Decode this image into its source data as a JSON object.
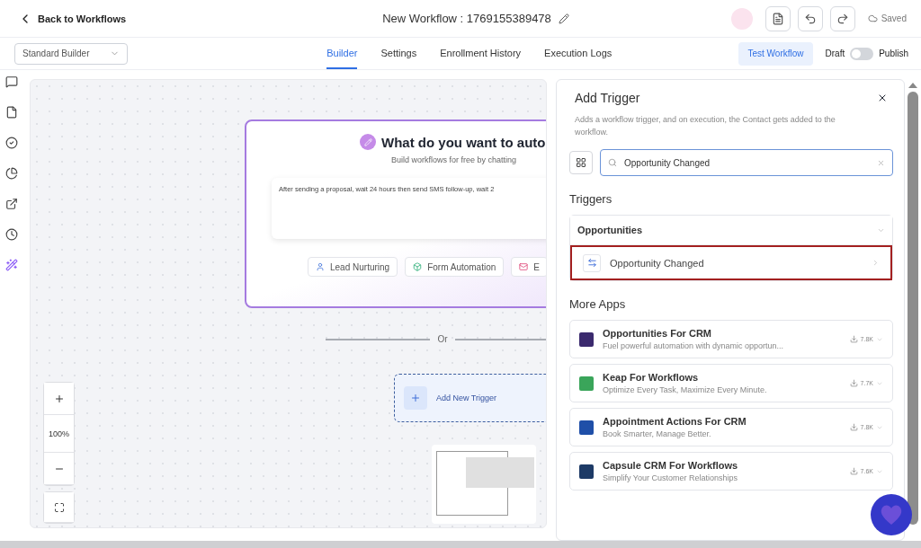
{
  "header": {
    "back_link": "Back to Workflows",
    "title": "New Workflow : 1769155389478",
    "saved": "Saved"
  },
  "toolbar": {
    "builder_select": "Standard Builder",
    "tabs": [
      {
        "label": "Builder",
        "selected": true
      },
      {
        "label": "Settings",
        "selected": false
      },
      {
        "label": "Enrollment History",
        "selected": false
      },
      {
        "label": "Execution Logs",
        "selected": false
      }
    ],
    "test_button": "Test Workflow",
    "draft_label": "Draft",
    "publish": {
      "on": false,
      "label": "Publish"
    }
  },
  "canvas": {
    "prompt_card": {
      "title": "What do you want to auto",
      "subtitle": "Build workflows for free by chatting",
      "prompt": "After sending a proposal, wait 24 hours then send SMS follow-up, wait 2",
      "chips": [
        {
          "label": "Lead Nurturing",
          "kind": "person"
        },
        {
          "label": "Form Automation",
          "kind": "form"
        },
        {
          "label": "E",
          "kind": "mail"
        }
      ]
    },
    "divider": "Or",
    "add_trigger": "Add New Trigger",
    "zoom_level": "100%"
  },
  "panel": {
    "title": "Add Trigger",
    "description": "Adds a workflow trigger, and on execution, the Contact gets added to the workflow.",
    "search": {
      "value": "Opportunity Changed"
    },
    "triggers_heading": "Triggers",
    "groups": [
      {
        "label": "Opportunities",
        "expanded": true,
        "items": [
          {
            "label": "Opportunity Changed",
            "selected": true
          }
        ]
      }
    ],
    "more_apps_heading": "More Apps",
    "apps": [
      {
        "name": "Opportunities For CRM",
        "description": "Fuel powerful automation with dynamic opportun...",
        "downloads": "7.8K",
        "color": "#3b2a6e"
      },
      {
        "name": "Keap For Workflows",
        "description": "Optimize Every Task, Maximize Every Minute.",
        "downloads": "7.7K",
        "color": "#3aa55a"
      },
      {
        "name": "Appointment Actions For CRM",
        "description": "Book Smarter, Manage Better.",
        "downloads": "7.8K",
        "color": "#1f4fa8"
      },
      {
        "name": "Capsule CRM For Workflows",
        "description": "Simplify Your Customer Relationships",
        "downloads": "7.6K",
        "color": "#1d3a66"
      }
    ]
  }
}
